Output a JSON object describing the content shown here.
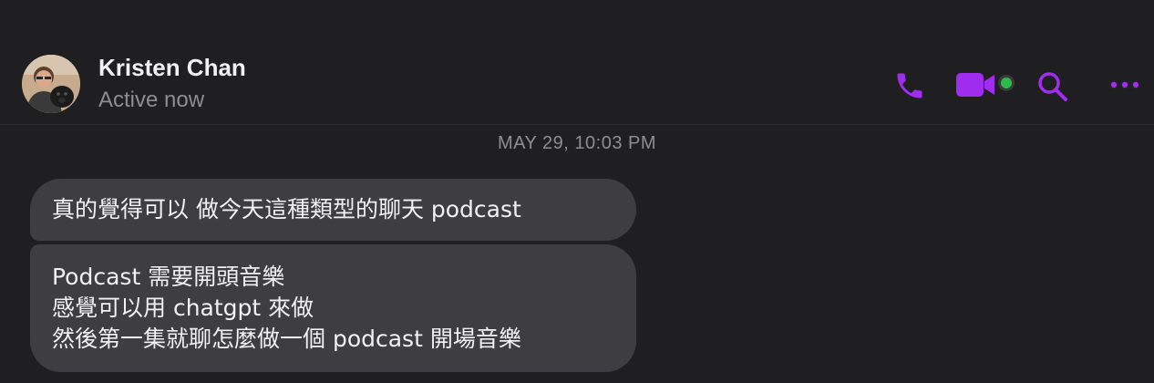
{
  "header": {
    "contact_name": "Kristen Chan",
    "contact_status": "Active now",
    "actions": [
      {
        "icon": "phone-icon",
        "label": "Call"
      },
      {
        "icon": "video-camera-icon",
        "label": "Video call"
      },
      {
        "icon": "search-icon",
        "label": "Search"
      },
      {
        "icon": "more-options-icon",
        "label": "More"
      }
    ],
    "online_indicator_color": "#2dbb4a"
  },
  "conversation": {
    "timestamp": "MAY 29, 10:03 PM",
    "messages": [
      {
        "lines": [
          "真的覺得可以 做今天這種類型的聊天 podcast"
        ]
      },
      {
        "lines": [
          "Podcast 需要開頭音樂",
          "感覺可以用 chatgpt 來做",
          "然後第一集就聊怎麼做一個 podcast 開場音樂"
        ]
      }
    ]
  },
  "colors": {
    "accent": "#a02cf0",
    "bubble_bg": "#3e3e42",
    "background": "#1f1f21",
    "secondary_text": "#8d8d93"
  }
}
